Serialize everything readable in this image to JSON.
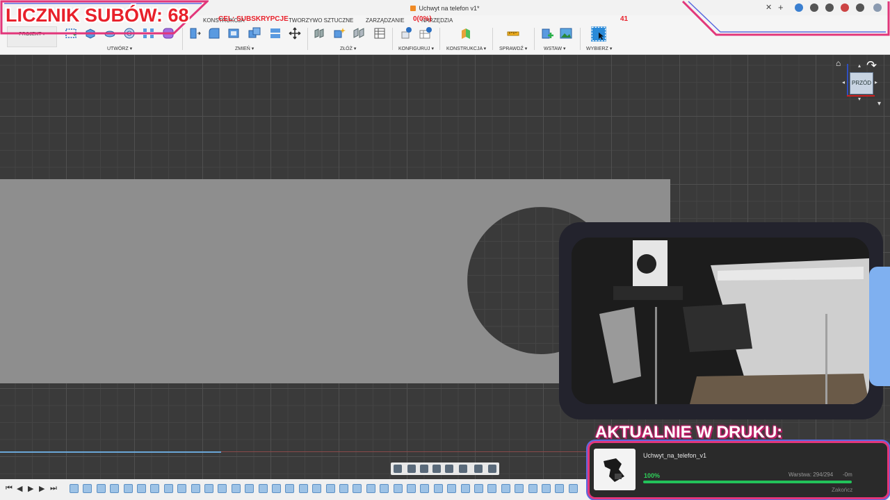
{
  "window": {
    "title": "Uchwyt na telefon v1*"
  },
  "ribbon": {
    "tabs": [
      "KONSTRUKCJA",
      "TWORZYWO SZTUCZNE",
      "ZARZĄDZANIE",
      "NARZĘDZIA"
    ],
    "project": "PROJEKT",
    "groups": [
      "UTWÓRZ",
      "ZMIEŃ",
      "ZŁÓŻ",
      "KONFIGURUJ",
      "KONSTRUKCJA",
      "SPRAWDŹ",
      "WSTAW",
      "WYBIERZ"
    ]
  },
  "viewcube": {
    "face": "PRZÓD"
  },
  "overlay": {
    "counter": "LICZNIK SUBÓW: 68",
    "goal": "CEL: SUBSKRYPCJE",
    "goal_count": "0(0%)",
    "goal_number": "41"
  },
  "print_status": {
    "heading": "AKTUALNIE W DRUKU:",
    "job_name": "Uchwyt_na_telefon_v1",
    "progress_text": "100%",
    "progress": 100,
    "layer": "Warstwa: 294/294",
    "remaining": "-0m",
    "end_button": "Zakończ"
  },
  "colors": {
    "accent_red": "#e8202a",
    "frame_pink": "#e2367a",
    "frame_blue": "#5a6ae0",
    "progress_green": "#22c25a"
  }
}
